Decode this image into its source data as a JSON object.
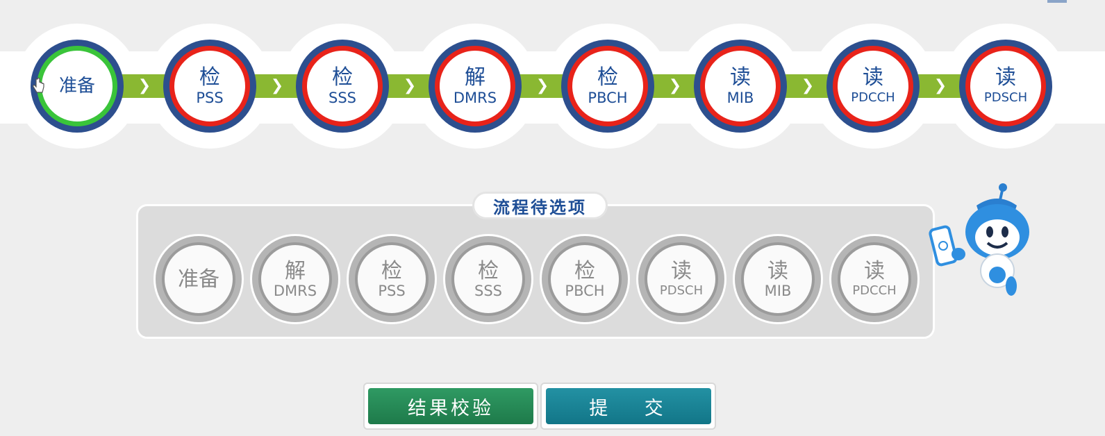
{
  "flow_steps": [
    {
      "zh": "准备",
      "en": "",
      "state": "done"
    },
    {
      "zh": "检",
      "en": "PSS",
      "state": "pending"
    },
    {
      "zh": "检",
      "en": "SSS",
      "state": "pending"
    },
    {
      "zh": "解",
      "en": "DMRS",
      "state": "pending"
    },
    {
      "zh": "检",
      "en": "PBCH",
      "state": "pending"
    },
    {
      "zh": "读",
      "en": "MIB",
      "state": "pending"
    },
    {
      "zh": "读",
      "en": "PDCCH",
      "state": "pending"
    },
    {
      "zh": "读",
      "en": "PDSCH",
      "state": "pending"
    }
  ],
  "pool": {
    "title": "流程待选项",
    "options": [
      {
        "zh": "准备",
        "en": ""
      },
      {
        "zh": "解",
        "en": "DMRS"
      },
      {
        "zh": "检",
        "en": "PSS"
      },
      {
        "zh": "检",
        "en": "SSS"
      },
      {
        "zh": "检",
        "en": "PBCH"
      },
      {
        "zh": "读",
        "en": "PDSCH"
      },
      {
        "zh": "读",
        "en": "MIB"
      },
      {
        "zh": "读",
        "en": "PDCCH"
      }
    ]
  },
  "buttons": {
    "check_label": "结果校验",
    "submit_label": "提 交"
  },
  "colors": {
    "step_done": "#3ac43a",
    "step_pending": "#e8231a",
    "step_outer": "#2d4f8e",
    "connector": "#8ab832",
    "check_button": "#238c58",
    "submit_button": "#1a8597"
  },
  "icons": {
    "connector": "chevron-right-icon",
    "cursor": "hand-pointer-icon",
    "mascot": "robot-mascot-icon"
  }
}
